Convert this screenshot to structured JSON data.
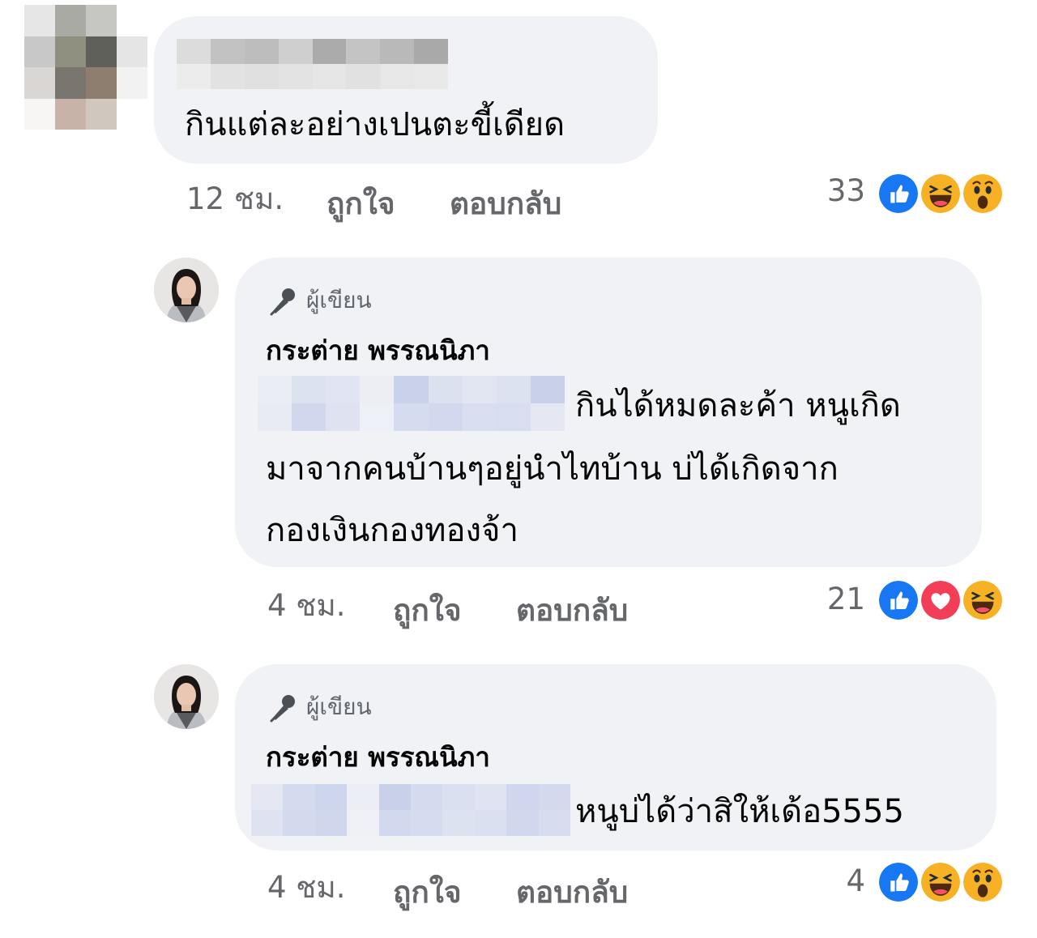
{
  "comments": [
    {
      "text": "กินแต่ละอย่างเปนตะขี้เดียด",
      "time": "12 ชม.",
      "like_label": "ถูกใจ",
      "reply_label": "ตอบกลับ",
      "reaction_count": "33",
      "reactions": [
        "like-icon",
        "haha-icon",
        "wow-icon"
      ]
    },
    {
      "badge": "ผู้เขียน",
      "author": "กระต่าย พรรณนิภา",
      "text_lines": [
        "กินได้หมดละค้า หนูเกิด",
        "มาจากคนบ้านๆอยู่นำไทบ้าน บ่ได้เกิดจาก",
        "กองเงินกองทองจ้า"
      ],
      "time": "4 ชม.",
      "like_label": "ถูกใจ",
      "reply_label": "ตอบกลับ",
      "reaction_count": "21",
      "reactions": [
        "like-icon",
        "love-icon",
        "haha-icon"
      ]
    },
    {
      "badge": "ผู้เขียน",
      "author": "กระต่าย พรรณนิภา",
      "text_lines": [
        "หนูบ่ได้ว่าสิให้เด้อ5555"
      ],
      "time": "4 ชม.",
      "like_label": "ถูกใจ",
      "reply_label": "ตอบกลับ",
      "reaction_count": "4",
      "reactions": [
        "like-icon",
        "haha-icon",
        "wow-icon"
      ]
    }
  ],
  "colors": {
    "bubble": "#f0f2f5",
    "meta_text": "#65676b",
    "like": "#1877f2",
    "love": "#f33e58",
    "haha_wow": "#f7b125"
  }
}
